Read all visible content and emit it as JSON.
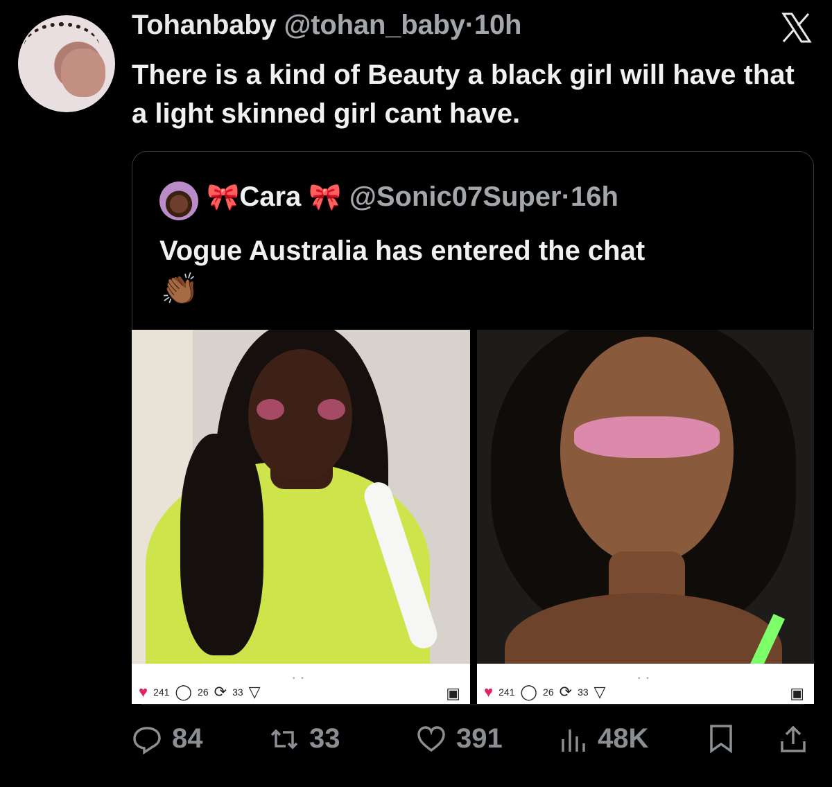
{
  "tweet": {
    "author_name": "Tohanbaby",
    "author_handle": "@tohan_baby",
    "separator": "·",
    "time": "10h",
    "text": "There is a kind of Beauty a black girl will have that a light skinned girl cant have."
  },
  "quoted_tweet": {
    "author_name": "Cara",
    "author_handle": "@Sonic07Super",
    "separator": "·",
    "time": "16h",
    "text": "Vogue Australia has entered the chat",
    "emoji": "👏🏾",
    "name_decoration": "🎀",
    "images": [
      {
        "likes": "241",
        "comments": "26",
        "retweets": "33",
        "carousel_dots": "• •"
      },
      {
        "likes": "241",
        "comments": "26",
        "retweets": "33",
        "carousel_dots": "• •"
      }
    ]
  },
  "actions": {
    "replies": "84",
    "retweets": "33",
    "likes": "391",
    "views": "48K"
  },
  "colors": {
    "background": "#000000",
    "text_primary": "#f0f1f2",
    "text_secondary": "#a3a7ab",
    "action_gray": "#8b8f93",
    "like_red": "#e0245e"
  },
  "icons": [
    "x-logo-icon",
    "reply-icon",
    "retweet-icon",
    "like-icon",
    "views-icon",
    "bookmark-icon",
    "share-icon"
  ]
}
